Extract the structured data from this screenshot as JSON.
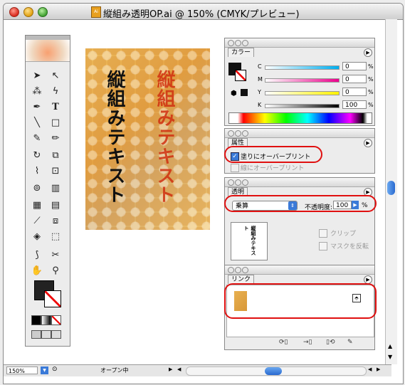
{
  "window": {
    "title": "縦組み透明OP.ai @ 150% (CMYK/プレビュー)",
    "doc_icon_text": "Ai"
  },
  "artwork": {
    "text_left": "縦組みテキスト",
    "text_right": "縦組みテキスト"
  },
  "color_panel": {
    "tab": "カラー",
    "channels": [
      {
        "label": "C",
        "value": "0"
      },
      {
        "label": "M",
        "value": "0"
      },
      {
        "label": "Y",
        "value": "0"
      },
      {
        "label": "K",
        "value": "100"
      }
    ],
    "unit": "%"
  },
  "attributes_panel": {
    "tab": "属性",
    "fill_overprint": "塗りにオーバープリント",
    "stroke_overprint": "線にオーバープリント"
  },
  "transparency_panel": {
    "tab": "透明",
    "blend_mode": "乗算",
    "opacity_label": "不透明度:",
    "opacity_value": "100",
    "unit": "%",
    "thumb_text": "縦組みテキスト",
    "clip_label": "クリップ",
    "invert_mask_label": "マスクを反転"
  },
  "links_panel": {
    "tab": "リンク"
  },
  "statusbar": {
    "zoom": "150%",
    "status": "オープン中"
  }
}
